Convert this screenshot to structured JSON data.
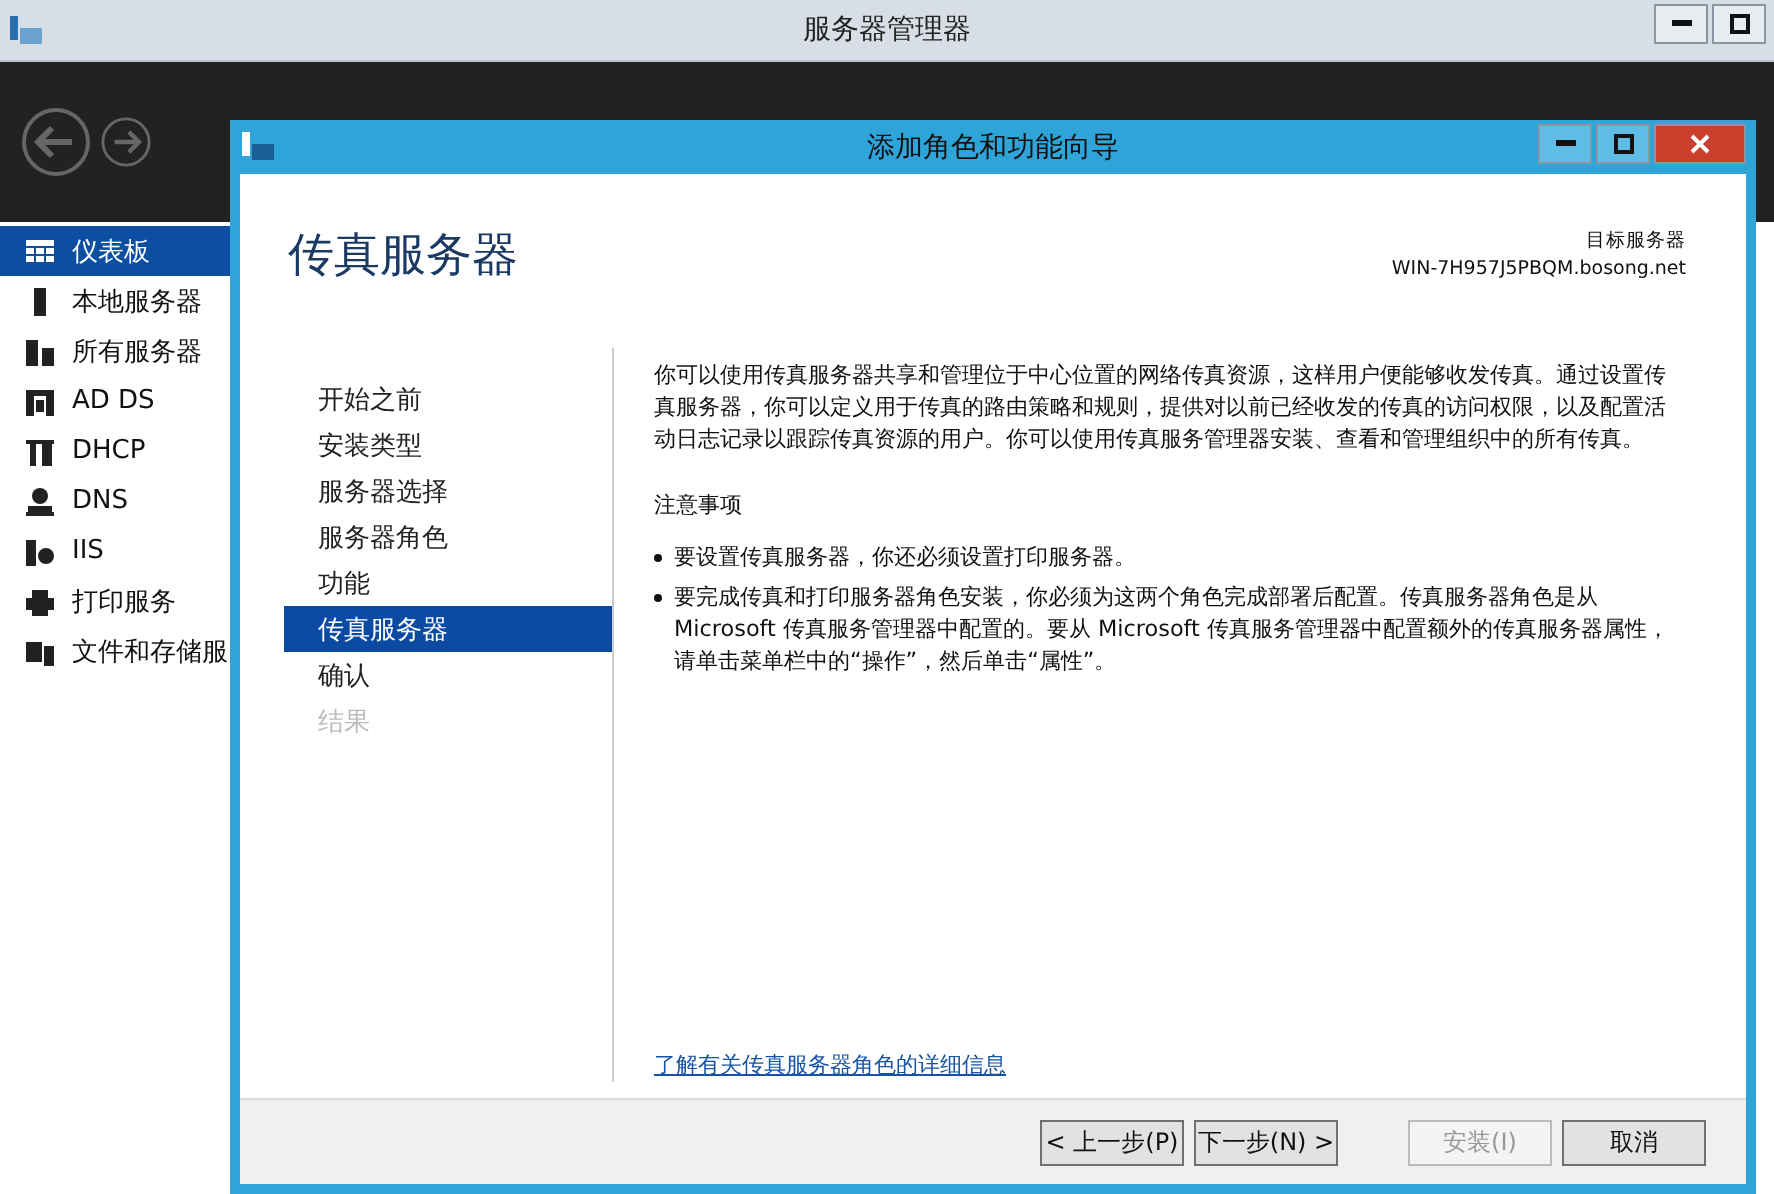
{
  "window": {
    "title": "服务器管理器"
  },
  "sidebar": {
    "items": [
      {
        "label": "仪表板",
        "selected": true
      },
      {
        "label": "本地服务器",
        "selected": false
      },
      {
        "label": "所有服务器",
        "selected": false
      },
      {
        "label": "AD DS",
        "selected": false
      },
      {
        "label": "DHCP",
        "selected": false
      },
      {
        "label": "DNS",
        "selected": false
      },
      {
        "label": "IIS",
        "selected": false
      },
      {
        "label": "打印服务",
        "selected": false
      },
      {
        "label": "文件和存储服",
        "selected": false
      }
    ]
  },
  "dialog": {
    "title": "添加角色和功能向导",
    "heading": "传真服务器",
    "target_label": "目标服务器",
    "target_server": "WIN-7H957J5PBQM.bosong.net",
    "steps": [
      {
        "label": "开始之前",
        "selected": false,
        "disabled": false
      },
      {
        "label": "安装类型",
        "selected": false,
        "disabled": false
      },
      {
        "label": "服务器选择",
        "selected": false,
        "disabled": false
      },
      {
        "label": "服务器角色",
        "selected": false,
        "disabled": false
      },
      {
        "label": "功能",
        "selected": false,
        "disabled": false
      },
      {
        "label": "传真服务器",
        "selected": true,
        "disabled": false
      },
      {
        "label": "确认",
        "selected": false,
        "disabled": false
      },
      {
        "label": "结果",
        "selected": false,
        "disabled": true
      }
    ],
    "description": "你可以使用传真服务器共享和管理位于中心位置的网络传真资源，这样用户便能够收发传真。通过设置传真服务器，你可以定义用于传真的路由策略和规则，提供对以前已经收发的传真的访问权限，以及配置活动日志记录以跟踪传真资源的用户。你可以使用传真服务管理器安装、查看和管理组织中的所有传真。",
    "notes_title": "注意事项",
    "notes": [
      "要设置传真服务器，你还必须设置打印服务器。",
      "要完成传真和打印服务器角色安装，你必须为这两个角色完成部署后配置。传真服务器角色是从 Microsoft 传真服务管理器中配置的。要从 Microsoft 传真服务管理器中配置额外的传真服务器属性，请单击菜单栏中的“操作”，然后单击“属性”。"
    ],
    "link": "了解有关传真服务器角色的详细信息",
    "buttons": [
      {
        "label": "< 上一步(P)",
        "disabled": false
      },
      {
        "label": "下一步(N) >",
        "disabled": false
      },
      {
        "label": "安装(I)",
        "disabled": true
      },
      {
        "label": "取消",
        "disabled": false
      }
    ]
  }
}
